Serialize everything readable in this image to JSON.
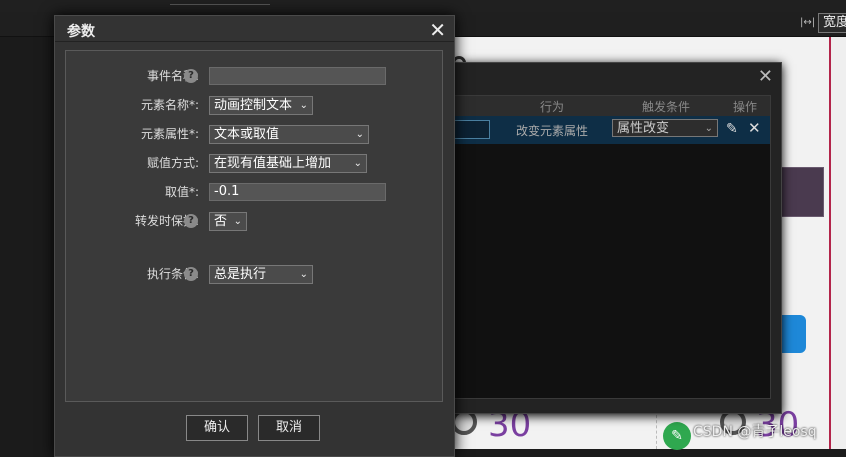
{
  "toolbar": {
    "width_label": "宽度"
  },
  "canvas": {
    "left_number": "30",
    "right_number": "30"
  },
  "behavior_dialog": {
    "close": "✕",
    "columns": {
      "behavior": "行为",
      "trigger": "触发条件",
      "ops": "操作"
    },
    "row": {
      "behavior": "改变元素属性",
      "trigger": "属性改变"
    }
  },
  "dialog": {
    "title": "参数",
    "close": "✕",
    "fields": {
      "event_name": {
        "label": "事件名称:",
        "value": ""
      },
      "element_name": {
        "label": "元素名称*:",
        "value": "动画控制文本"
      },
      "element_attr": {
        "label": "元素属性*:",
        "value": "文本或取值"
      },
      "assign_mode": {
        "label": "赋值方式:",
        "value": "在现有值基础上增加"
      },
      "value": {
        "label": "取值*:",
        "value": "-0.1"
      },
      "keep_on_forward": {
        "label": "转发时保持:",
        "value": "否"
      },
      "exec_condition": {
        "label": "执行条件:",
        "value": "总是执行"
      }
    },
    "help_glyph": "?",
    "chevron": "⌄",
    "buttons": {
      "ok": "确认",
      "cancel": "取消"
    }
  },
  "watermark": "CSDN @青子leosq"
}
